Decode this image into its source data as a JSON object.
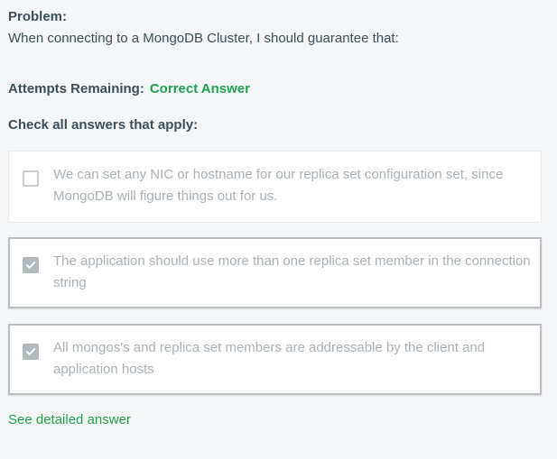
{
  "problem": {
    "title": "Problem:",
    "text": "When connecting to a MongoDB Cluster, I should guarantee that:"
  },
  "attempts": {
    "label": "Attempts Remaining:",
    "value": "Correct Answer"
  },
  "instruction": "Check all answers that apply:",
  "options": [
    {
      "text": "We can set any NIC or hostname for our replica set configuration set, since MongoDB will figure things out for us.",
      "checked": false
    },
    {
      "text": "The application should use more than one replica set member in the connection string",
      "checked": true
    },
    {
      "text": "All mongos's and replica set members are addressable by the client and application hosts",
      "checked": true
    }
  ],
  "see_answer_link": "See detailed answer",
  "colors": {
    "correct_green": "#21a24f",
    "text_dark": "#3d4f58",
    "option_text_muted": "#a9b2b7",
    "checkbox_checked": "#b1bbc0",
    "background": "#f5f6f7"
  }
}
